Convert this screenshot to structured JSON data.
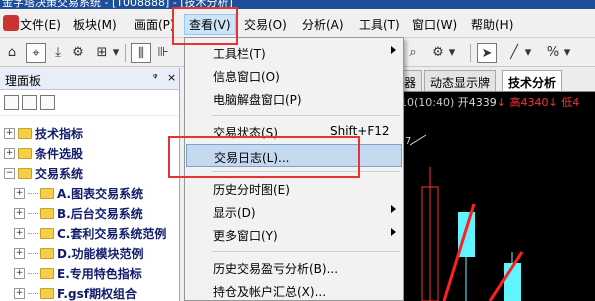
{
  "titlebar": {
    "text": "金字塔决策交易系统 - [T008888] - [技术分析]"
  },
  "menubar": {
    "items": [
      "文件(E)",
      "板块(M)",
      "画面(P)",
      "查看(V)",
      "交易(O)",
      "分析(A)",
      "工具(T)",
      "窗口(W)",
      "帮助(H)"
    ]
  },
  "toolbar": {
    "buttons": [
      "⌂",
      "⌖",
      "⤓",
      "⊞",
      "▾",
      "⫼",
      "⌕",
      "⚙",
      "▾",
      "➤",
      "╱",
      "▾",
      "%",
      "▾"
    ]
  },
  "left_panel": {
    "title": "理面板",
    "pin": "ᵠ",
    "close": "×",
    "tree": [
      {
        "label": "技术指标",
        "level": 0
      },
      {
        "label": "条件选股",
        "level": 0
      },
      {
        "label": "交易系统",
        "level": 0
      },
      {
        "label": "A.图表交易系统",
        "level": 1
      },
      {
        "label": "B.后台交易系统",
        "level": 1
      },
      {
        "label": "C.套利交易系统范例",
        "level": 1
      },
      {
        "label": "D.功能模块范例",
        "level": 1
      },
      {
        "label": "E.专用特色指标",
        "level": 1
      },
      {
        "label": "F.gsf期权组合",
        "level": 1
      }
    ]
  },
  "tabs": [
    "器",
    "动态显示牌",
    "技术分析"
  ],
  "chart": {
    "time": "10(10:40)",
    "open": "开4339",
    "open_arrow": "↓",
    "high": "高4340",
    "high_arrow": "↓",
    "low": "低4",
    "side_label": "7"
  },
  "view_menu": {
    "items": [
      {
        "label": "工具栏(T)",
        "shortcut": "",
        "submenu": true
      },
      {
        "label": "信息窗口(O)",
        "shortcut": "",
        "submenu": false
      },
      {
        "label": "电脑解盘窗口(P)",
        "shortcut": "",
        "submenu": false
      },
      {
        "label": "交易状态(S)",
        "shortcut": "Shift+F12",
        "submenu": false
      },
      {
        "label": "交易日志(L)...",
        "shortcut": "",
        "submenu": false
      },
      {
        "label": "历史分时图(E)",
        "shortcut": "",
        "submenu": false
      },
      {
        "label": "显示(D)",
        "shortcut": "",
        "submenu": true
      },
      {
        "label": "更多窗口(Y)",
        "shortcut": "",
        "submenu": true
      },
      {
        "label": "历史交易盈亏分析(B)...",
        "shortcut": "",
        "submenu": false
      },
      {
        "label": "持仓及帐户汇总(X)...",
        "shortcut": "",
        "submenu": false
      }
    ]
  },
  "colors": {
    "menu_highlight": "#c4d9ef",
    "annotation_red": "#e63434",
    "candle_cyan": "#5ff4ff",
    "chart_bg": "#000000"
  }
}
